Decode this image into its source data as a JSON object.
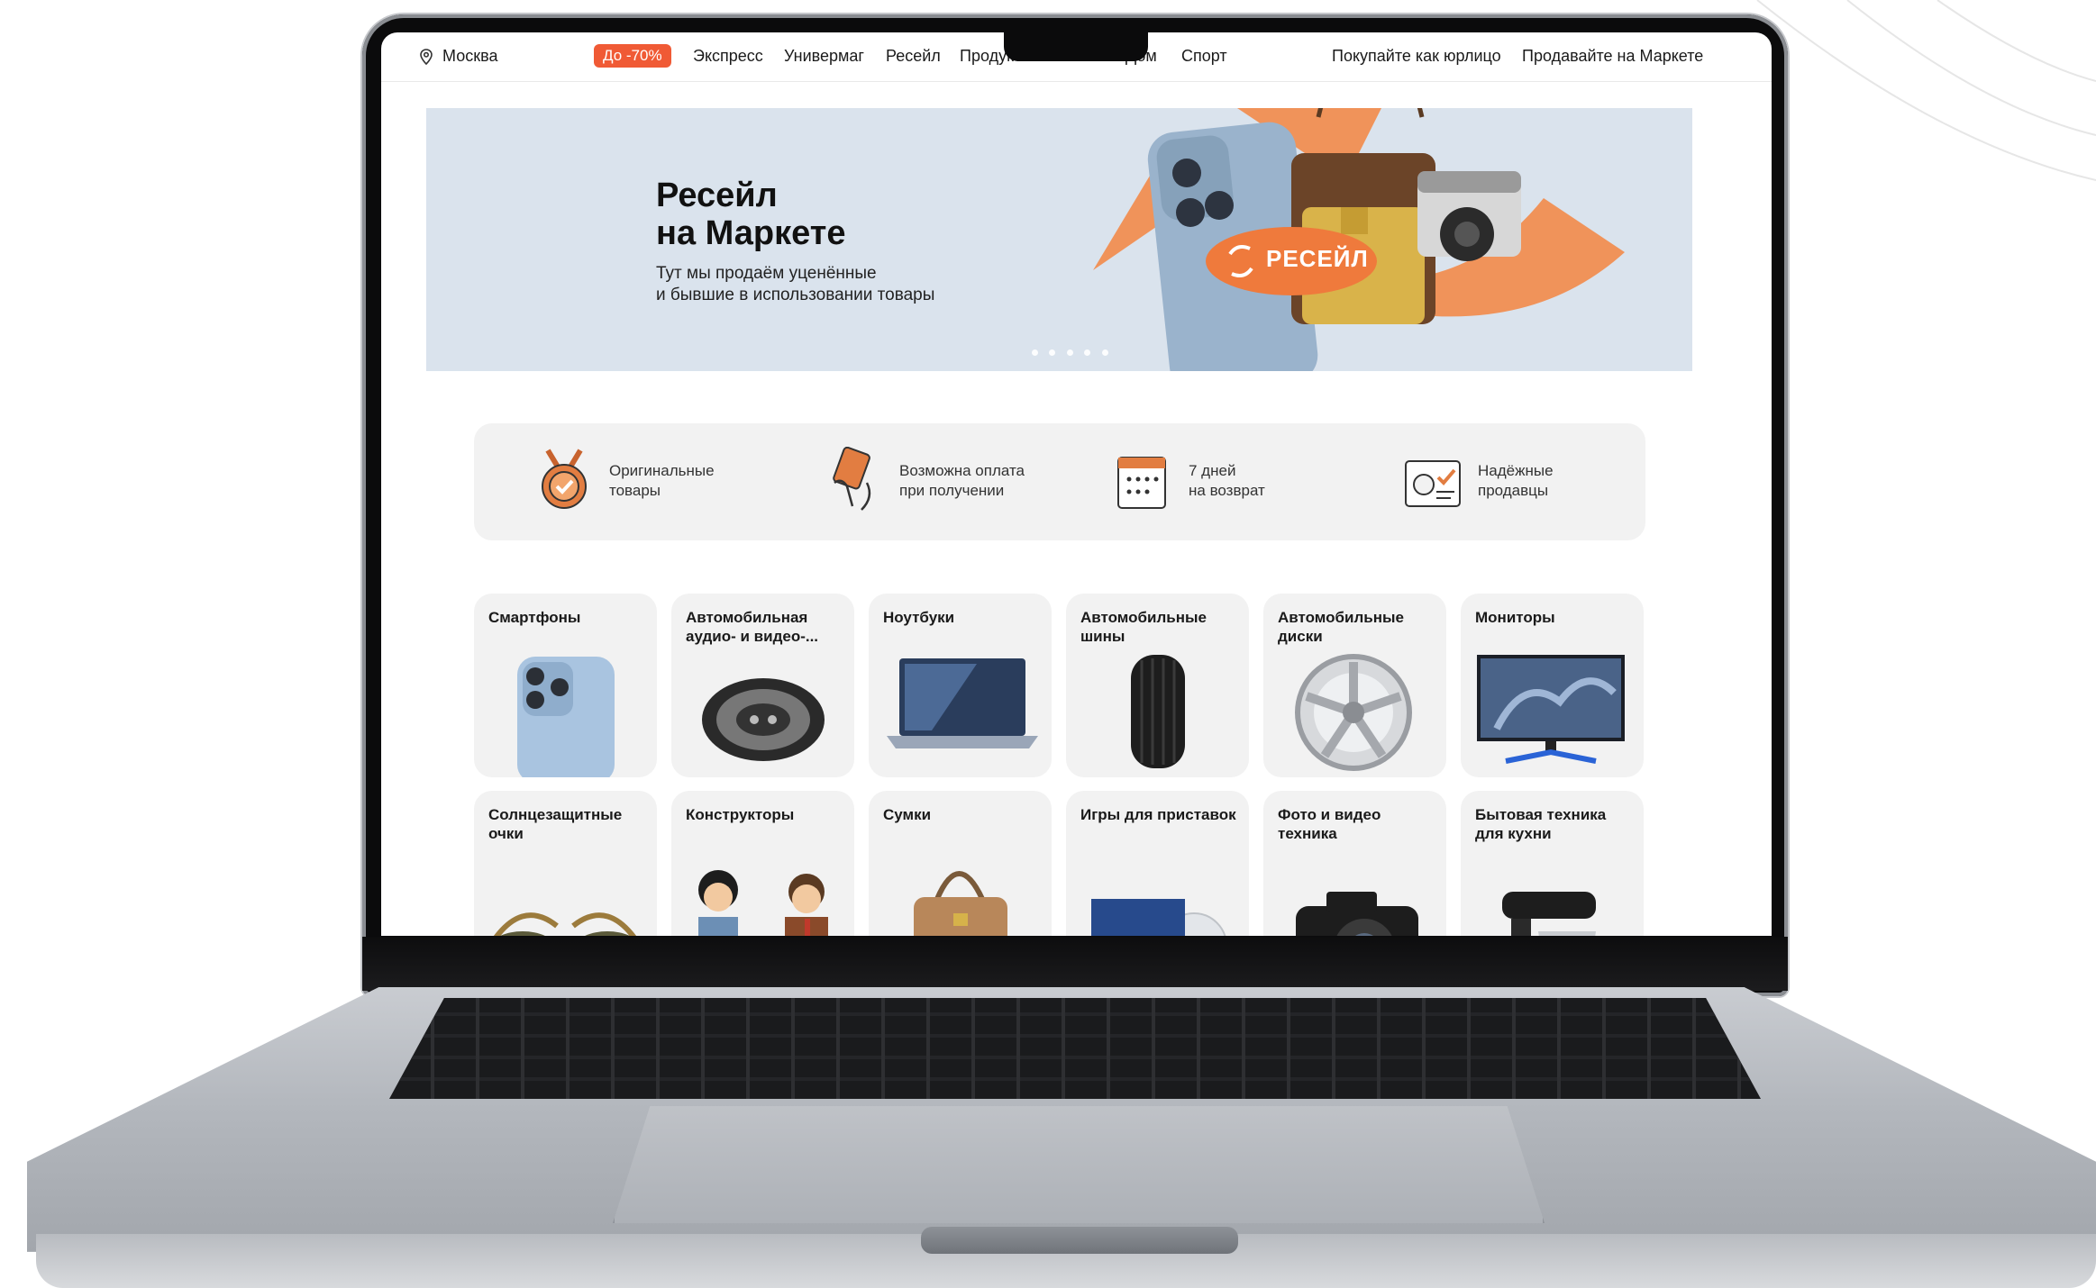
{
  "topbar": {
    "location": "Москва",
    "sale_badge": "До -70%",
    "nav": [
      "Экспресс",
      "Универмаг",
      "Ресейл",
      "Продукты",
      "Дом",
      "Спорт"
    ],
    "business_link": "Покупайте как юрлицо",
    "sell_link": "Продавайте на Маркете"
  },
  "banner": {
    "title": "Ресейл\nна Маркете",
    "subtitle": "Тут мы продаём уценённые\nи бывшие в использовании товары",
    "sticker": "РЕСЕЙЛ",
    "slide_count": 5
  },
  "features": [
    {
      "text": "Оригинальные\nтовары",
      "icon": "medal-icon"
    },
    {
      "text": "Возможна оплата\nпри получении",
      "icon": "card-payment-icon"
    },
    {
      "text": "7 дней\nна возврат",
      "icon": "calendar-icon"
    },
    {
      "text": "Надёжные\nпродавцы",
      "icon": "verified-seller-icon"
    }
  ],
  "categories": [
    {
      "label": "Смартфоны",
      "icon": "smartphone-icon"
    },
    {
      "label": "Автомобильная\nаудио- и видео-...",
      "icon": "car-speaker-icon"
    },
    {
      "label": "Ноутбуки",
      "icon": "laptop-icon"
    },
    {
      "label": "Автомобильные\nшины",
      "icon": "tire-icon"
    },
    {
      "label": "Автомобильные\nдиски",
      "icon": "wheel-rim-icon"
    },
    {
      "label": "Мониторы",
      "icon": "monitor-icon"
    },
    {
      "label": "Солнцезащитные\nочки",
      "icon": "sunglasses-icon"
    },
    {
      "label": "Конструкторы",
      "icon": "lego-figures-icon"
    },
    {
      "label": "Сумки",
      "icon": "handbag-icon"
    },
    {
      "label": "Игры для приставок",
      "icon": "game-disc-icon"
    },
    {
      "label": "Фото и видео\nтехника",
      "icon": "camera-icon"
    },
    {
      "label": "Бытовая техника\nдля кухни",
      "icon": "kitchen-mixer-icon"
    }
  ],
  "colors": {
    "accent": "#f05a35",
    "banner_bg": "#dae3ed",
    "card_bg": "#f2f2f2",
    "feature_icon": "#e07a3f"
  }
}
